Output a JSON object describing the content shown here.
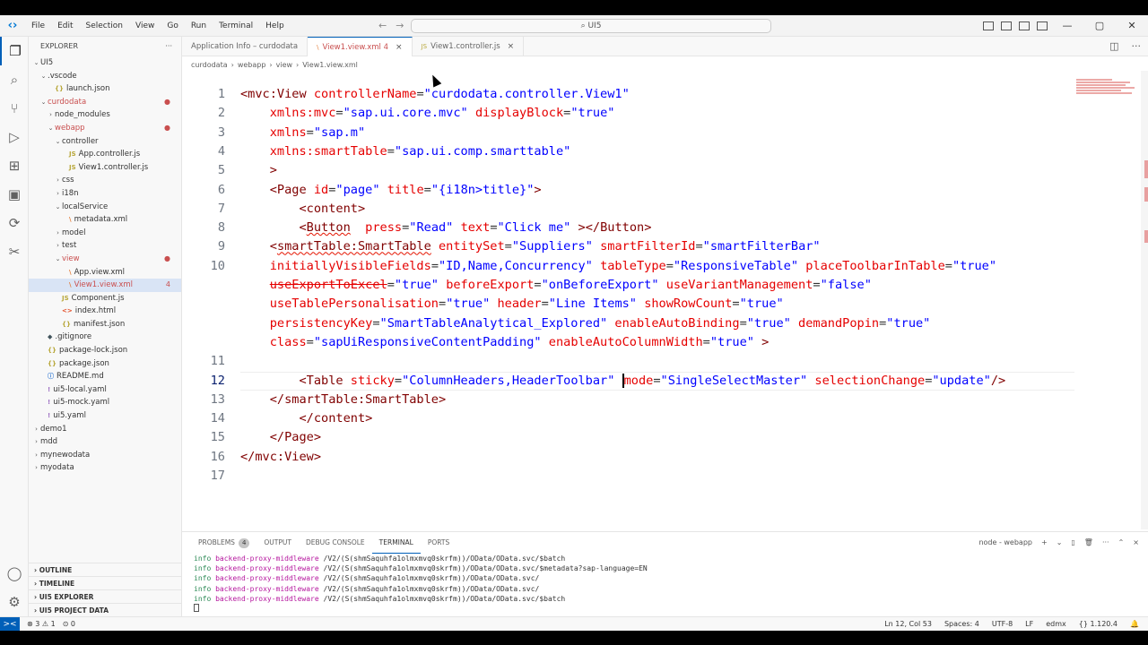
{
  "titlebar": {
    "logo": "‹›",
    "menu": [
      "File",
      "Edit",
      "Selection",
      "View",
      "Go",
      "Run",
      "Terminal",
      "Help"
    ],
    "search": "UI5"
  },
  "sidebar": {
    "header": "EXPLORER",
    "more": "···",
    "tree": [
      {
        "label": "UI5",
        "indent": 0,
        "chev": "⌄",
        "icon": "",
        "cls": ""
      },
      {
        "label": ".vscode",
        "indent": 1,
        "chev": "⌄",
        "icon": "",
        "cls": ""
      },
      {
        "label": "launch.json",
        "indent": 2,
        "chev": "",
        "icon": "{}",
        "cls": "json"
      },
      {
        "label": "curdodata",
        "indent": 1,
        "chev": "⌄",
        "icon": "",
        "cls": "",
        "red": true,
        "mod": "●"
      },
      {
        "label": "node_modules",
        "indent": 2,
        "chev": "›",
        "icon": "",
        "cls": ""
      },
      {
        "label": "webapp",
        "indent": 2,
        "chev": "⌄",
        "icon": "",
        "cls": "",
        "red": true,
        "mod": "●"
      },
      {
        "label": "controller",
        "indent": 3,
        "chev": "⌄",
        "icon": "",
        "cls": ""
      },
      {
        "label": "App.controller.js",
        "indent": 4,
        "chev": "",
        "icon": "JS",
        "cls": "js"
      },
      {
        "label": "View1.controller.js",
        "indent": 4,
        "chev": "",
        "icon": "JS",
        "cls": "js"
      },
      {
        "label": "css",
        "indent": 3,
        "chev": "›",
        "icon": "",
        "cls": ""
      },
      {
        "label": "i18n",
        "indent": 3,
        "chev": "›",
        "icon": "",
        "cls": ""
      },
      {
        "label": "localService",
        "indent": 3,
        "chev": "⌄",
        "icon": "",
        "cls": ""
      },
      {
        "label": "metadata.xml",
        "indent": 4,
        "chev": "",
        "icon": "\\",
        "cls": "xml"
      },
      {
        "label": "model",
        "indent": 3,
        "chev": "›",
        "icon": "",
        "cls": ""
      },
      {
        "label": "test",
        "indent": 3,
        "chev": "›",
        "icon": "",
        "cls": ""
      },
      {
        "label": "view",
        "indent": 3,
        "chev": "⌄",
        "icon": "",
        "cls": "",
        "red": true,
        "mod": "●"
      },
      {
        "label": "App.view.xml",
        "indent": 4,
        "chev": "",
        "icon": "\\",
        "cls": "xml"
      },
      {
        "label": "View1.view.xml",
        "indent": 4,
        "chev": "",
        "icon": "\\",
        "cls": "xml",
        "red": true,
        "mod": "4",
        "sel": true
      },
      {
        "label": "Component.js",
        "indent": 3,
        "chev": "",
        "icon": "JS",
        "cls": "js"
      },
      {
        "label": "index.html",
        "indent": 3,
        "chev": "",
        "icon": "<>",
        "cls": "html"
      },
      {
        "label": "manifest.json",
        "indent": 3,
        "chev": "",
        "icon": "{}",
        "cls": "json"
      },
      {
        "label": ".gitignore",
        "indent": 1,
        "chev": "",
        "icon": "◆",
        "cls": "git"
      },
      {
        "label": "package-lock.json",
        "indent": 1,
        "chev": "",
        "icon": "{}",
        "cls": "json"
      },
      {
        "label": "package.json",
        "indent": 1,
        "chev": "",
        "icon": "{}",
        "cls": "json"
      },
      {
        "label": "README.md",
        "indent": 1,
        "chev": "",
        "icon": "ⓘ",
        "cls": "md"
      },
      {
        "label": "ui5-local.yaml",
        "indent": 1,
        "chev": "",
        "icon": "!",
        "cls": "yaml"
      },
      {
        "label": "ui5-mock.yaml",
        "indent": 1,
        "chev": "",
        "icon": "!",
        "cls": "yaml"
      },
      {
        "label": "ui5.yaml",
        "indent": 1,
        "chev": "",
        "icon": "!",
        "cls": "yaml"
      },
      {
        "label": "demo1",
        "indent": 0,
        "chev": "›",
        "icon": "",
        "cls": ""
      },
      {
        "label": "mdd",
        "indent": 0,
        "chev": "›",
        "icon": "",
        "cls": ""
      },
      {
        "label": "mynewodata",
        "indent": 0,
        "chev": "›",
        "icon": "",
        "cls": ""
      },
      {
        "label": "myodata",
        "indent": 0,
        "chev": "›",
        "icon": "",
        "cls": ""
      }
    ],
    "sections": [
      "OUTLINE",
      "TIMELINE",
      "UI5 EXPLORER",
      "UI5 PROJECT DATA"
    ]
  },
  "tabs": [
    {
      "label": "Application Info – curdodata",
      "icon": "",
      "active": false,
      "close": ""
    },
    {
      "label": "View1.view.xml 4",
      "icon": "\\",
      "active": true,
      "close": "×"
    },
    {
      "label": "View1.controller.js",
      "icon": "JS",
      "active": false,
      "close": "×"
    }
  ],
  "breadcrumb": [
    "curdodata",
    "›",
    "webapp",
    "›",
    "view",
    "›",
    "View1.view.xml"
  ],
  "code_lines": [
    {
      "n": "1",
      "html": "<span class='t'>&lt;mvc:View</span> <span class='a'>controllerName</span><span class='d'>=</span><span class='s'>\"curdodata.controller.View1\"</span>"
    },
    {
      "n": "2",
      "html": "    <span class='a'>xmlns:mvc</span><span class='d'>=</span><span class='s'>\"sap.ui.core.mvc\"</span> <span class='a'>displayBlock</span><span class='d'>=</span><span class='s'>\"true\"</span>"
    },
    {
      "n": "3",
      "html": "    <span class='a'>xmlns</span><span class='d'>=</span><span class='s'>\"sap.m\"</span>"
    },
    {
      "n": "4",
      "html": "    <span class='a'>xmlns:smartTable</span><span class='d'>=</span><span class='s'>\"sap.ui.comp.smarttable\"</span>"
    },
    {
      "n": "5",
      "html": "    <span class='t'>&gt;</span>"
    },
    {
      "n": "6",
      "html": "    <span class='t'>&lt;Page</span> <span class='a'>id</span><span class='d'>=</span><span class='s'>\"page\"</span> <span class='a'>title</span><span class='d'>=</span><span class='s'>\"{i18n&gt;title}\"</span><span class='t'>&gt;</span>"
    },
    {
      "n": "7",
      "html": "        <span class='t'>&lt;content&gt;</span>"
    },
    {
      "n": "8",
      "html": "        <span class='t'>&lt;<span class='squig'>Button</span></span>  <span class='a'>press</span><span class='d'>=</span><span class='s'>\"Read\"</span> <span class='a'>text</span><span class='d'>=</span><span class='s'>\"Click me\"</span> <span class='t'>&gt;&lt;/Button&gt;</span>"
    },
    {
      "n": "9",
      "html": "    <span class='t'>&lt;<span class='squig'>smartTable:SmartTable</span></span> <span class='a'>entitySet</span><span class='d'>=</span><span class='s'>\"Suppliers\"</span> <span class='a'>smartFilterId</span><span class='d'>=</span><span class='s'>\"smartFilterBar\"</span>"
    },
    {
      "n": "10",
      "html": "    <span class='a'>initiallyVisibleFields</span><span class='d'>=</span><span class='s'>\"ID,Name,Concurrency\"</span> <span class='a'>tableType</span><span class='d'>=</span><span class='s'>\"ResponsiveTable\"</span> <span class='a'>placeToolbarInTable</span><span class='d'>=</span><span class='s'>\"true\"</span>"
    },
    {
      "n": "",
      "html": "    <span class='a strike'>useExportToExcel</span><span class='d'>=</span><span class='s'>\"true\"</span> <span class='a'>beforeExport</span><span class='d'>=</span><span class='s'>\"onBeforeExport\"</span> <span class='a'>useVariantManagement</span><span class='d'>=</span><span class='s'>\"false\"</span>"
    },
    {
      "n": "",
      "html": "    <span class='a'>useTablePersonalisation</span><span class='d'>=</span><span class='s'>\"true\"</span> <span class='a'>header</span><span class='d'>=</span><span class='s'>\"Line Items\"</span> <span class='a'>showRowCount</span><span class='d'>=</span><span class='s'>\"true\"</span>"
    },
    {
      "n": "",
      "html": "    <span class='a'>persistencyKey</span><span class='d'>=</span><span class='s'>\"SmartTableAnalytical_Explored\"</span> <span class='a'>enableAutoBinding</span><span class='d'>=</span><span class='s'>\"true\"</span> <span class='a'>demandPopin</span><span class='d'>=</span><span class='s'>\"true\"</span>"
    },
    {
      "n": "",
      "html": "    <span class='a'>class</span><span class='d'>=</span><span class='s'>\"sapUiResponsiveContentPadding\"</span> <span class='a'>enableAutoColumnWidth</span><span class='d'>=</span><span class='s'>\"true\"</span> <span class='t'>&gt;</span>"
    },
    {
      "n": "11",
      "html": ""
    },
    {
      "n": "12",
      "html": "        <span class='t'>&lt;Table</span> <span class='a'>sticky</span><span class='d'>=</span><span class='s'>\"ColumnHeaders,HeaderToolbar\"</span> <span class='cursor'></span><span class='a'>mode</span><span class='d'>=</span><span class='s'>\"SingleSelectMaster\"</span> <span class='a'>selectionChange</span><span class='d'>=</span><span class='s'>\"update\"</span><span class='t'>/&gt;</span>",
      "current": true
    },
    {
      "n": "13",
      "html": "    <span class='t'>&lt;/smartTable:SmartTable&gt;</span>"
    },
    {
      "n": "14",
      "html": "        <span class='t'>&lt;/content&gt;</span>"
    },
    {
      "n": "15",
      "html": "    <span class='t'>&lt;/Page&gt;</span>"
    },
    {
      "n": "16",
      "html": "<span class='t'>&lt;/mvc:View&gt;</span>"
    },
    {
      "n": "17",
      "html": ""
    }
  ],
  "panel": {
    "tabs": [
      {
        "label": "PROBLEMS",
        "badge": "4",
        "active": false
      },
      {
        "label": "OUTPUT",
        "badge": "",
        "active": false
      },
      {
        "label": "DEBUG CONSOLE",
        "badge": "",
        "active": false
      },
      {
        "label": "TERMINAL",
        "badge": "",
        "active": true
      },
      {
        "label": "PORTS",
        "badge": "",
        "active": false
      }
    ],
    "terminal_name": "node - webapp",
    "actions": [
      "+",
      "⌄",
      "▯",
      "🗑",
      "···",
      "⌃",
      "×"
    ],
    "lines": [
      {
        "info": "info",
        "mw": "backend-proxy-middleware",
        "rest": " /V2/(S(shmSaquhfa1olmxmvq0skrfm))/OData/OData.svc/$batch"
      },
      {
        "info": "info",
        "mw": "backend-proxy-middleware",
        "rest": " /V2/(S(shmSaquhfa1olmxmvq0skrfm))/OData/OData.svc/$metadata?sap-language=EN"
      },
      {
        "info": "info",
        "mw": "backend-proxy-middleware",
        "rest": " /V2/(S(shmSaquhfa1olmxmvq0skrfm))/OData/OData.svc/"
      },
      {
        "info": "info",
        "mw": "backend-proxy-middleware",
        "rest": " /V2/(S(shmSaquhfa1olmxmvq0skrfm))/OData/OData.svc/"
      },
      {
        "info": "info",
        "mw": "backend-proxy-middleware",
        "rest": " /V2/(S(shmSaquhfa1olmxmvq0skrfm))/OData/OData.svc/$batch"
      }
    ]
  },
  "statusbar": {
    "remote": "><",
    "errors": "⊗ 3 ⚠ 1",
    "ports": "⊙ 0",
    "right": [
      "Ln 12, Col 53",
      "Spaces: 4",
      "UTF-8",
      "LF",
      "edmx",
      "{} 1.120.4",
      "🔔"
    ]
  }
}
